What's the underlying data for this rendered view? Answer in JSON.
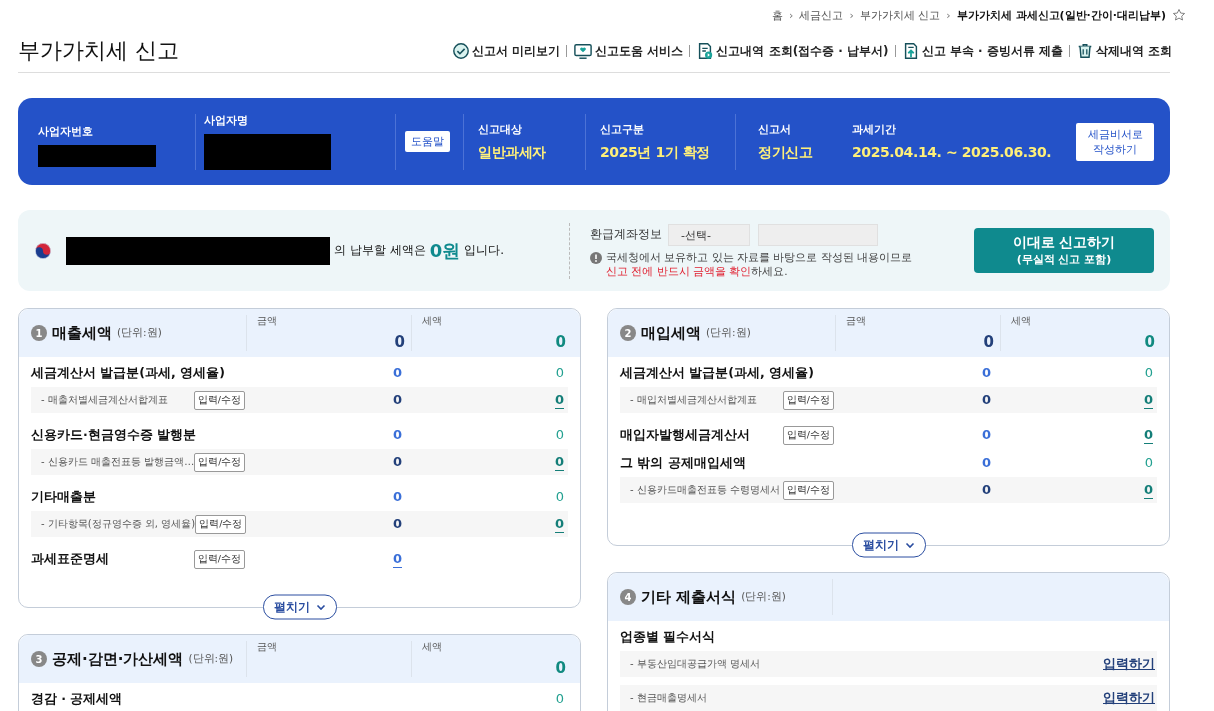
{
  "breadcrumb": [
    {
      "label": "홈",
      "current": false
    },
    {
      "label": "세금신고",
      "current": false
    },
    {
      "label": "부가가치세 신고",
      "current": false
    },
    {
      "label": "부가가치세 과세신고(일반·간이·대리납부)",
      "current": true
    }
  ],
  "breadcrumb_separator": "›",
  "page_title": "부가가치세 신고",
  "toolbar": [
    {
      "label": "신고서 미리보기",
      "kind": "check"
    },
    {
      "label": "신고도움 서비스",
      "kind": "monitor"
    },
    {
      "label": "신고내역 조회(접수증 · 납부서)",
      "kind": "document"
    },
    {
      "label": "신고 부속 · 증빙서류 제출",
      "kind": "upload"
    },
    {
      "label": "삭제내역 조회",
      "kind": "trash"
    }
  ],
  "banner": {
    "business_number_label": "사업자번호",
    "business_name_label": "사업자명",
    "help_button": "도움말",
    "fields": [
      {
        "label": "신고대상",
        "value": "일반과세자"
      },
      {
        "label": "신고구분",
        "value": "2025년 1기 확정"
      },
      {
        "label": "신고서",
        "value": "정기신고"
      },
      {
        "label": "과세기간",
        "value": "2025.04.14. ~ 2025.06.30."
      }
    ],
    "assistant_button": [
      "세금비서로",
      "작성하기"
    ]
  },
  "summary": {
    "prefix": "의 납부할 세액은",
    "amount": "0원",
    "suffix": "입니다.",
    "refund_label": "환급계좌정보",
    "bank_select": "-선택-",
    "notice": "국세청에서 보유하고 있는 자료를 바탕으로 작성된 내용이므로",
    "notice_highlight": "신고 전에 반드시 금액을 확인",
    "notice_end": "하세요.",
    "submit_title": "이대로 신고하기",
    "submit_subtitle": "(무실적 신고 포함)"
  },
  "left_column": [
    {
      "kind": "amounts",
      "number": "1",
      "title": "매출세액",
      "unit": "(단위:원)",
      "amount_header": "금액",
      "amount_total": "0",
      "tax_header": "세액",
      "tax_total": "0",
      "expand_button": "펼치기",
      "rows": [
        {
          "kind": "main",
          "label": "세금계산서 발급분(과세, 영세율)",
          "amount": "0",
          "tax": "0",
          "amount_link": false,
          "tax_link": false
        },
        {
          "kind": "sub",
          "label": "- 매출처별세금계산서합계표",
          "button": "입력/수정",
          "amount": "0",
          "tax": "0",
          "amount_link": false,
          "tax_link": true
        },
        {
          "kind": "main",
          "label": "신용카드·현금영수증 발행분",
          "amount": "0",
          "tax": "0",
          "amount_link": false,
          "tax_link": false
        },
        {
          "kind": "sub",
          "label": "- 신용카드 매출전표등 발행금액…",
          "button": "입력/수정",
          "amount": "0",
          "tax": "0",
          "amount_link": false,
          "tax_link": true
        },
        {
          "kind": "main",
          "label": "기타매출분",
          "amount": "0",
          "tax": "0",
          "amount_link": false,
          "tax_link": false
        },
        {
          "kind": "sub",
          "label": "- 기타항목(정규영수증 외, 영세율)",
          "button": "입력/수정",
          "amount": "0",
          "tax": "0",
          "amount_link": false,
          "tax_link": true
        },
        {
          "kind": "main",
          "label": "과세표준명세",
          "button": "입력/수정",
          "amount": "0",
          "amount_link": true
        }
      ]
    },
    {
      "kind": "amounts",
      "number": "3",
      "title": "공제·감면·가산세액",
      "unit": "(단위:원)",
      "amount_header": "금액",
      "tax_header": "세액",
      "tax_total": "0",
      "rows": [
        {
          "kind": "main",
          "label": "경감 · 공제세액",
          "tax": "0",
          "tax_link": false
        }
      ]
    }
  ],
  "right_column": [
    {
      "kind": "amounts",
      "number": "2",
      "title": "매입세액",
      "unit": "(단위:원)",
      "amount_header": "금액",
      "amount_total": "0",
      "tax_header": "세액",
      "tax_total": "0",
      "expand_button": "펼치기",
      "rows": [
        {
          "kind": "main",
          "label": "세금계산서 발급분(과세, 영세율)",
          "amount": "0",
          "tax": "0",
          "amount_link": false,
          "tax_link": false
        },
        {
          "kind": "sub",
          "label": "- 매입처별세금계산서합계표",
          "button": "입력/수정",
          "amount": "0",
          "tax": "0",
          "amount_link": false,
          "tax_link": true
        },
        {
          "kind": "main",
          "label": "매입자발행세금계산서",
          "button": "입력/수정",
          "amount": "0",
          "tax": "0",
          "amount_link": false,
          "tax_link": true
        },
        {
          "kind": "main",
          "label": "그 밖의 공제매입세액",
          "amount": "0",
          "tax": "0",
          "amount_link": false,
          "tax_link": false
        },
        {
          "kind": "sub",
          "label": "- 신용카드매출전표등 수령명세서",
          "button": "입력/수정",
          "amount": "0",
          "tax": "0",
          "amount_link": false,
          "tax_link": true
        }
      ]
    },
    {
      "kind": "forms",
      "number": "4",
      "title": "기타 제출서식",
      "unit": "(단위:원)",
      "rows": [
        {
          "kind": "main",
          "label": "업종별 필수서식"
        },
        {
          "kind": "sub",
          "label": "- 부동산임대공급가액 명세서",
          "link": "입력하기"
        },
        {
          "kind": "sub",
          "label": "- 현금매출명세서",
          "link": "입력하기"
        }
      ]
    }
  ]
}
